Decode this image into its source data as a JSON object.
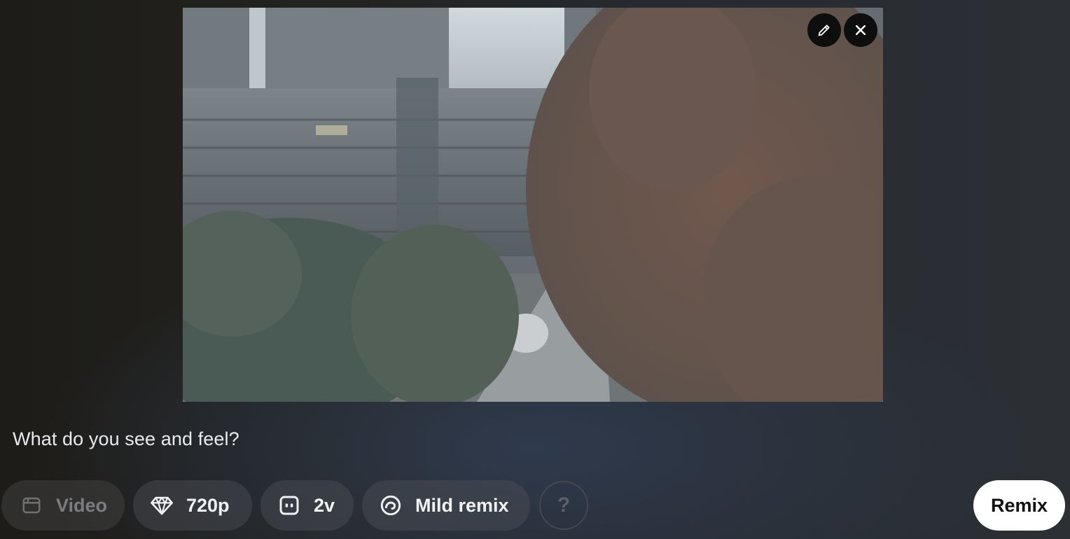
{
  "media": {
    "icon": "rainy-window-photo",
    "edit_icon": "pencil-icon",
    "close_icon": "close-icon"
  },
  "prompt": {
    "text": "What do you see and feel?"
  },
  "toolbar": {
    "video": {
      "label": "Video",
      "icon": "video-clip-icon",
      "enabled": false
    },
    "resolution": {
      "label": "720p",
      "icon": "diamond-icon"
    },
    "variations": {
      "label": "2v",
      "icon": "variations-icon"
    },
    "remix_strength": {
      "label": "Mild remix",
      "icon": "remix-icon"
    },
    "help": {
      "label": "?"
    }
  },
  "actions": {
    "remix_label": "Remix"
  },
  "colors": {
    "background": "#22221f",
    "pill": "#3a3c41",
    "primary_button": "#ffffff",
    "text": "#f1f2f4"
  }
}
